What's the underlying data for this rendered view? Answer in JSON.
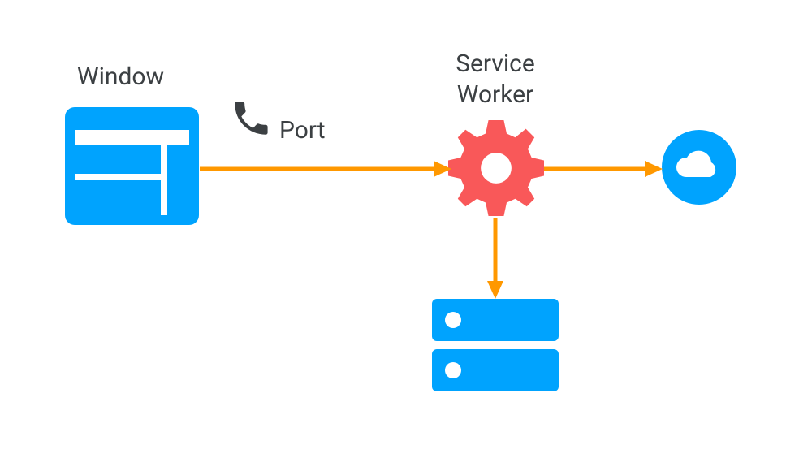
{
  "labels": {
    "window": "Window",
    "port": "Port",
    "service_worker_line1": "Service",
    "service_worker_line2": "Worker"
  },
  "colors": {
    "blue": "#00A3FE",
    "orange": "#FF9800",
    "red": "#F95859",
    "dark": "#3c4043",
    "white": "#ffffff"
  },
  "diagram": {
    "nodes": [
      {
        "id": "window",
        "type": "browser-window"
      },
      {
        "id": "port",
        "type": "phone-channel"
      },
      {
        "id": "service-worker",
        "type": "gear"
      },
      {
        "id": "cache",
        "type": "storage"
      },
      {
        "id": "cloud",
        "type": "network"
      }
    ],
    "edges": [
      {
        "from": "window",
        "to": "service-worker",
        "via": "port"
      },
      {
        "from": "service-worker",
        "to": "cloud"
      },
      {
        "from": "service-worker",
        "to": "cache"
      }
    ]
  }
}
